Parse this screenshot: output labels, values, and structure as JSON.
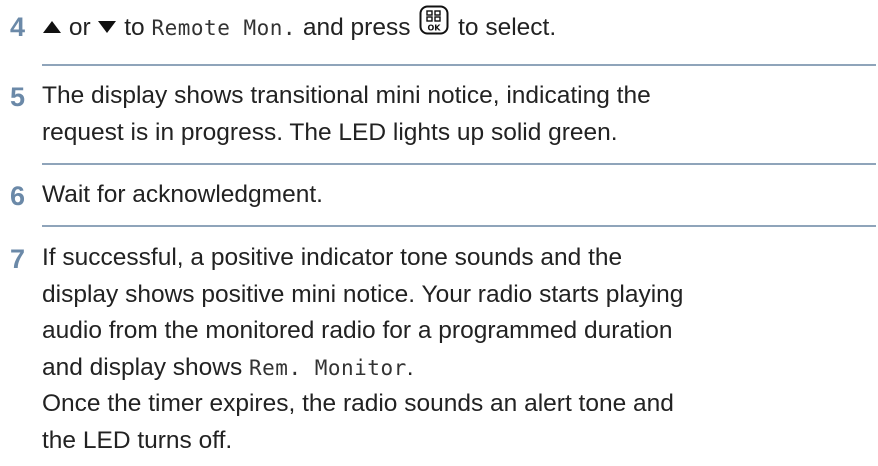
{
  "steps": [
    {
      "number": "4",
      "part_or": "or",
      "part_to": "to",
      "display_text": "Remote Mon.",
      "part_press": "and press",
      "part_select": "to select.",
      "ok_key_label": "OK"
    },
    {
      "number": "5",
      "line1": "The display shows transitional mini notice, indicating the",
      "line2": "request is in progress. The LED lights up solid green."
    },
    {
      "number": "6",
      "line1": "Wait for acknowledgment."
    },
    {
      "number": "7",
      "line1": "If successful, a positive indicator tone sounds and the",
      "line2": "display shows positive mini notice. Your radio starts playing",
      "line3": "audio from the monitored radio for a programmed duration",
      "line4_prefix": "and display shows",
      "line4_display": "Rem. Monitor",
      "line4_suffix": ".",
      "line5": "Once the timer expires, the radio sounds an alert tone and",
      "line6": "the LED turns off."
    }
  ],
  "colors": {
    "step_number": "#6b89a8",
    "divider": "#8fa4ba",
    "text": "#222222"
  },
  "icons": [
    "up-arrow-icon",
    "down-arrow-icon",
    "ok-menu-key-icon"
  ]
}
